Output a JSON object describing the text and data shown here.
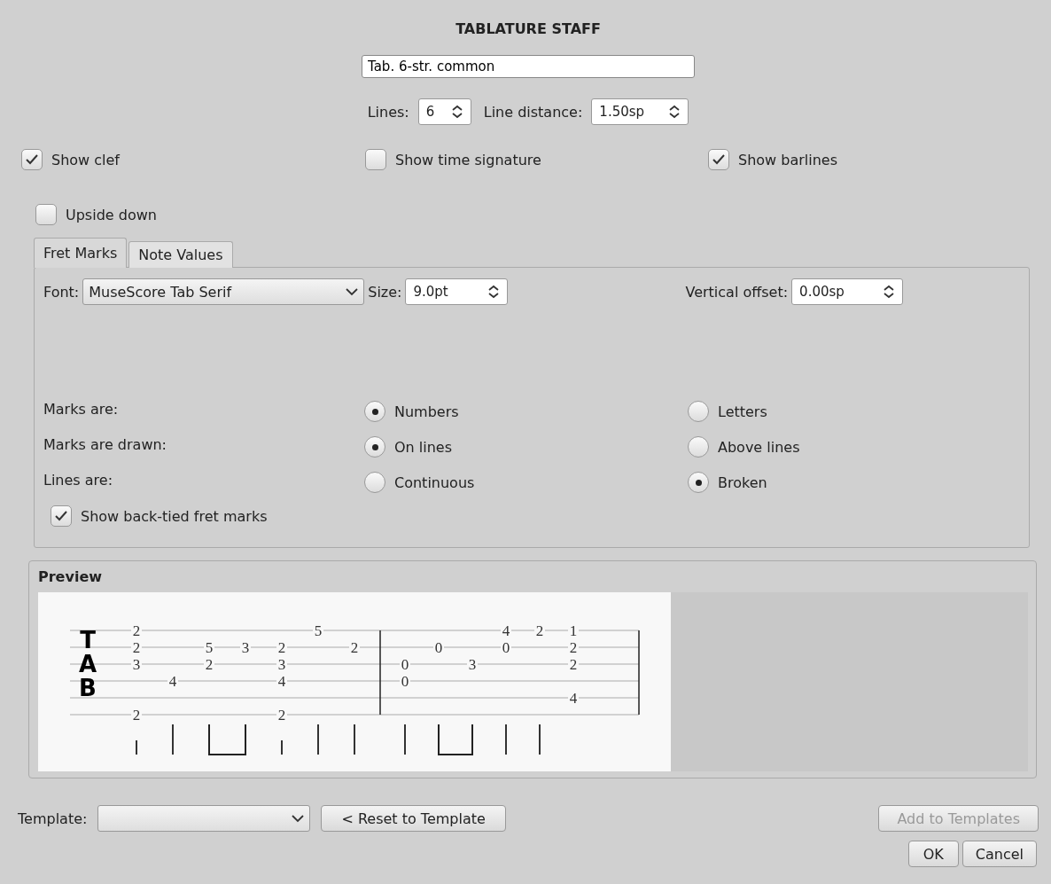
{
  "dialog": {
    "title": "TABLATURE STAFF"
  },
  "name_field": {
    "value": "Tab. 6-str. common"
  },
  "spinners": [
    {
      "label": "Lines:",
      "value": "6"
    },
    {
      "label": "Line distance:",
      "value": "1.50sp"
    }
  ],
  "options": [
    {
      "label": "Show clef",
      "checked": true
    },
    {
      "label": "Show time signature",
      "checked": false
    },
    {
      "label": "Show barlines",
      "checked": true
    }
  ],
  "upside_down": {
    "label": "Upside down",
    "checked": false
  },
  "tabs": [
    {
      "label": "Fret Marks",
      "selected": true
    },
    {
      "label": "Note Values",
      "selected": false
    }
  ],
  "fret_marks": {
    "font": {
      "label": "Font:",
      "value": "MuseScore Tab Serif"
    },
    "size": {
      "label": "Size:",
      "value": "9.0pt"
    },
    "vertical_offset": {
      "label": "Vertical offset:",
      "value": "0.00sp"
    },
    "radio_rows": [
      {
        "label": "Marks are:",
        "options": [
          {
            "label": "Numbers",
            "selected": true
          },
          {
            "label": "Letters",
            "selected": false
          }
        ]
      },
      {
        "label": "Marks are drawn:",
        "options": [
          {
            "label": "On lines",
            "selected": true
          },
          {
            "label": "Above lines",
            "selected": false
          }
        ]
      },
      {
        "label": "Lines are:",
        "options": [
          {
            "label": "Continuous",
            "selected": false
          },
          {
            "label": "Broken",
            "selected": true
          }
        ]
      }
    ],
    "back_tied": {
      "label": "Show back-tied fret marks",
      "checked": true
    }
  },
  "preview": {
    "title": "Preview",
    "clef": [
      "T",
      "A",
      "B"
    ],
    "measures": [
      {
        "beats": [
          {
            "frets": {
              "string_1": "2",
              "string_2": "2",
              "string_3": "3",
              "string_6": "2"
            },
            "kind": "short"
          },
          {
            "frets": {
              "string_4": "4"
            },
            "kind": "long"
          },
          {
            "frets": {
              "string_2": "5",
              "string_3": "2"
            },
            "kind": "beam-start"
          },
          {
            "frets": {
              "string_2": "3"
            },
            "kind": "beam-end"
          },
          {
            "frets": {
              "string_2": "2",
              "string_3": "3",
              "string_4": "4",
              "string_6": "2"
            },
            "kind": "short"
          },
          {
            "frets": {
              "string_1": "5"
            },
            "kind": "long"
          },
          {
            "frets": {
              "string_2": "2"
            },
            "kind": "long"
          }
        ]
      },
      {
        "beats": [
          {
            "frets": {
              "string_3": "0",
              "string_4": "0"
            },
            "kind": "long"
          },
          {
            "frets": {
              "string_2": "0"
            },
            "kind": "beam-start"
          },
          {
            "frets": {
              "string_3": "3"
            },
            "kind": "beam-end"
          },
          {
            "frets": {
              "string_1": "4",
              "string_2": "0"
            },
            "kind": "long"
          },
          {
            "frets": {
              "string_1": "2"
            },
            "kind": "long"
          },
          {
            "frets": {
              "string_1": "1",
              "string_2": "2",
              "string_3": "2",
              "string_5": "4"
            },
            "kind": "bare"
          }
        ]
      }
    ]
  },
  "template": {
    "label": "Template:",
    "reset_button": "< Reset to Template",
    "add_button": {
      "label": "Add to Templates",
      "disabled": true
    }
  },
  "buttons": [
    "OK",
    "Cancel"
  ]
}
